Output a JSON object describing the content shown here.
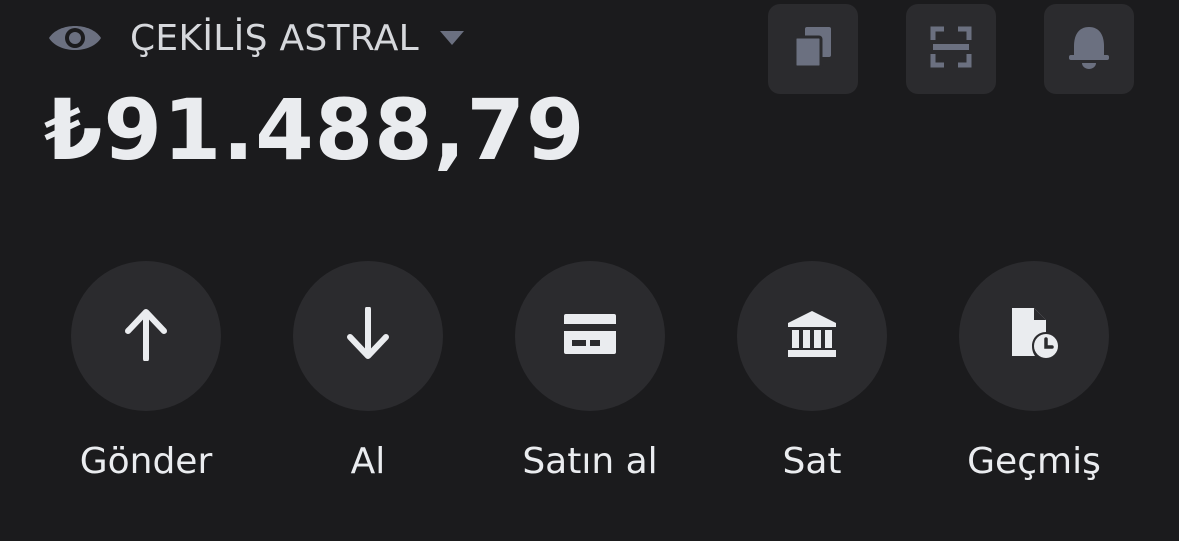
{
  "header": {
    "visibility_icon": "eye-icon",
    "account_name": "ÇEKİLİŞ ASTRAL",
    "dropdown_icon": "caret-down-icon"
  },
  "balance": {
    "amount": "₺91.488,79"
  },
  "top_actions": [
    {
      "icon": "copy-icon"
    },
    {
      "icon": "scan-icon"
    },
    {
      "icon": "bell-icon"
    }
  ],
  "actions": [
    {
      "label": "Gönder",
      "icon": "arrow-up-icon"
    },
    {
      "label": "Al",
      "icon": "arrow-down-icon"
    },
    {
      "label": "Satın al",
      "icon": "card-icon"
    },
    {
      "label": "Sat",
      "icon": "bank-icon"
    },
    {
      "label": "Geçmiş",
      "icon": "history-icon"
    }
  ],
  "colors": {
    "background": "#1b1b1d",
    "button_bg": "#2b2b2e",
    "text_primary": "#eaecef",
    "icon_muted": "#6b7080"
  }
}
